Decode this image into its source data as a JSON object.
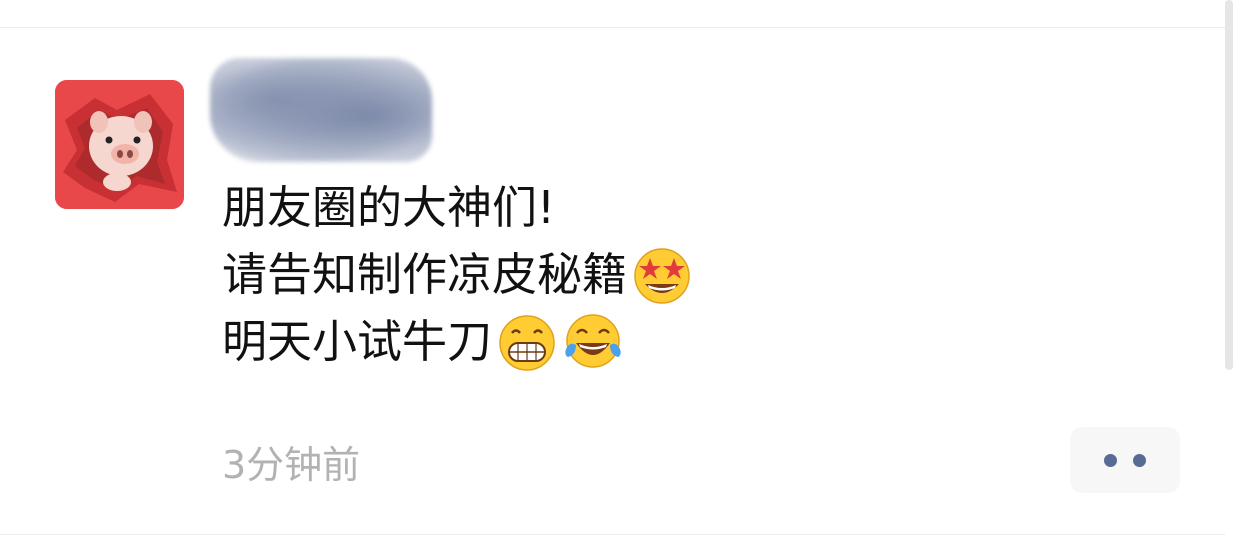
{
  "post": {
    "author_name": "",
    "lines": [
      {
        "text": "朋友圈的大神们!",
        "emojis": []
      },
      {
        "text": "请告知制作凉皮秘籍",
        "emojis": [
          "star-struck-emoji"
        ]
      },
      {
        "text": "明天小试牛刀",
        "emojis": [
          "grinning-face-emoji",
          "tears-of-joy-emoji"
        ]
      }
    ],
    "timestamp": "3分钟前"
  },
  "colors": {
    "text": "#111111",
    "timestamp": "#b2b2b2",
    "link_blue": "#576b95",
    "avatar_bg": "#e8484a",
    "more_button_bg": "#f7f7f7"
  }
}
